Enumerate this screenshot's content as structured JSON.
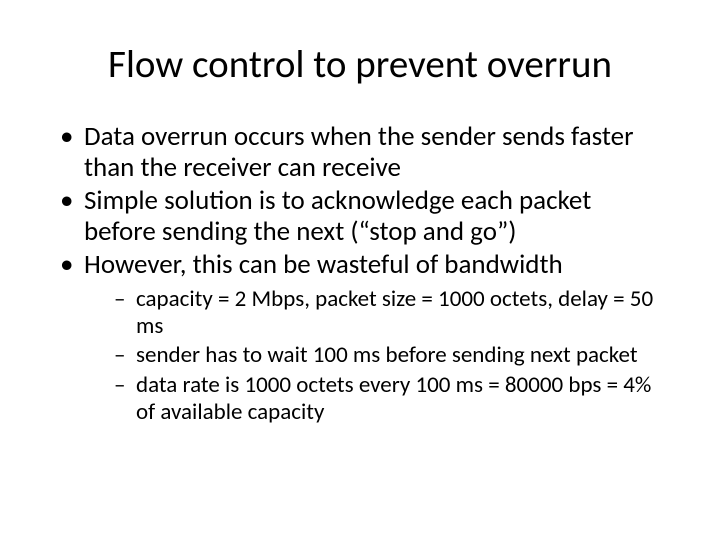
{
  "slide": {
    "title": "Flow control to prevent overrun",
    "bullets": [
      {
        "text": "Data overrun occurs when the sender sends faster than the receiver can receive"
      },
      {
        "text": "Simple solution is to acknowledge each packet before sending the next (“stop and go”)"
      },
      {
        "text": "However, this can be wasteful of bandwidth",
        "sub": [
          "capacity = 2 Mbps, packet size = 1000 octets, delay = 50 ms",
          "sender has to wait 100 ms before sending next packet",
          "data rate is 1000 octets every 100 ms = 80000 bps = 4% of available capacity"
        ]
      }
    ]
  }
}
